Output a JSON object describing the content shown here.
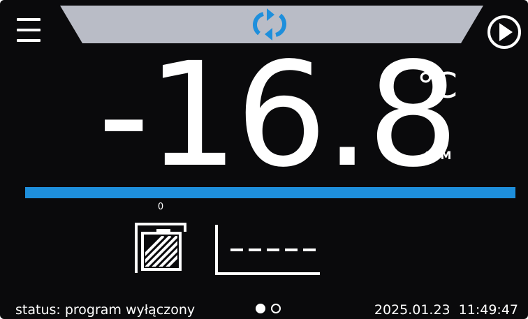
{
  "header": {
    "menu_icon": "hamburger-menu-icon",
    "sync_icon": "sync-arrows-icon",
    "play_icon": "play-circle-icon",
    "banner_color": "#b9bcc6",
    "accent_color": "#1e8fdc"
  },
  "reading": {
    "temperature": "-16.8",
    "unit": "°C",
    "sensor": "STM"
  },
  "progress": {
    "fraction": 1.0,
    "color": "#1e8fdc"
  },
  "indicators": {
    "door_count": "0",
    "door_icon": "chamber-door-icon",
    "graph_icon": "temperature-graph-icon"
  },
  "footer": {
    "status": "status: program wyłączony",
    "date": "2025.01.23",
    "time": "11:49:47",
    "pages": 2,
    "active_page": 1
  }
}
